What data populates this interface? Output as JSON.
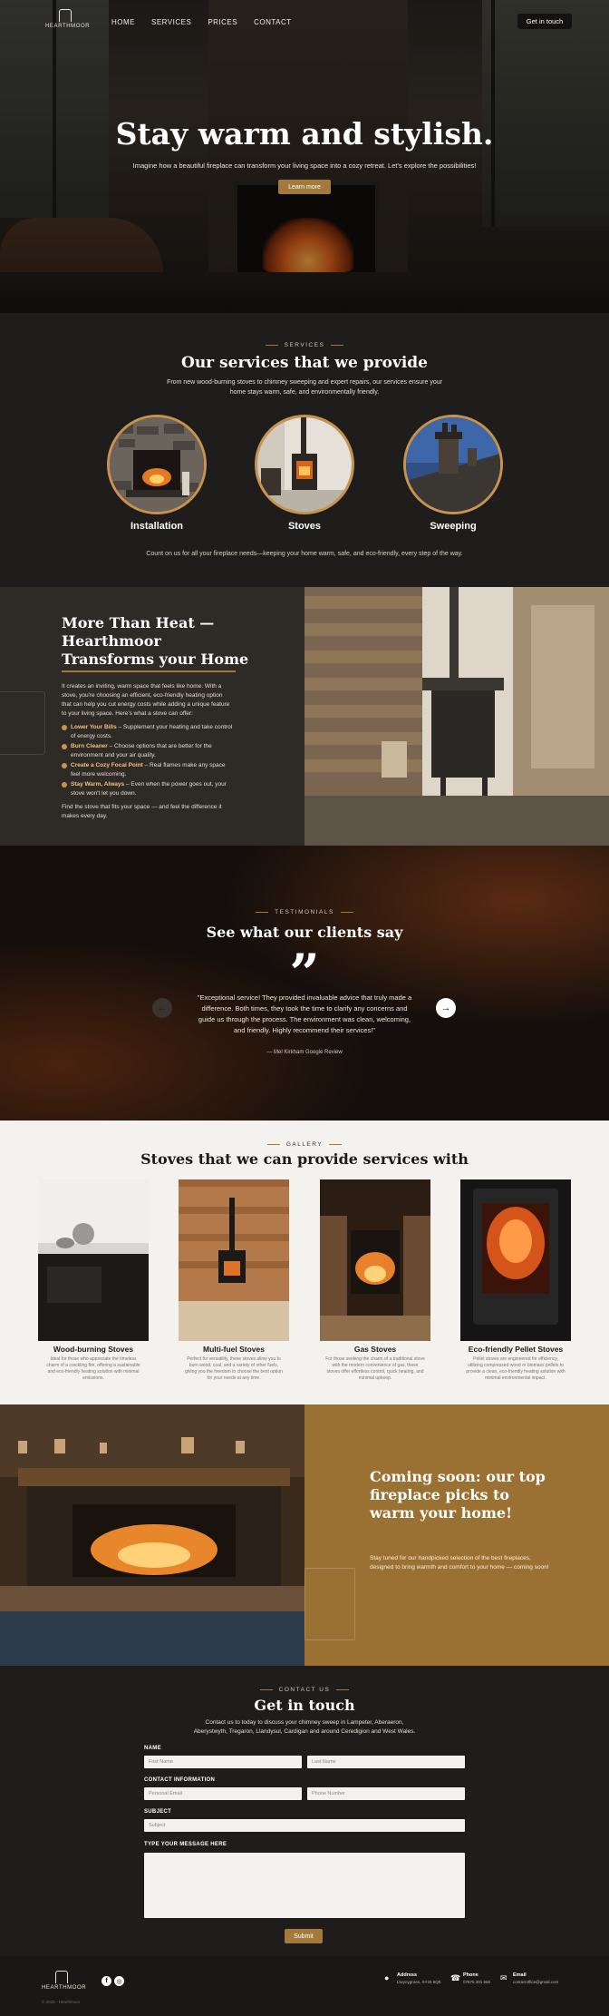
{
  "brand": {
    "name": "HEARTHMOOR"
  },
  "nav": {
    "items": [
      "HOME",
      "SERVICES",
      "PRICES",
      "CONTACT"
    ],
    "cta": "Get in touch"
  },
  "hero": {
    "title": "Stay warm and stylish.",
    "subtitle": "Imagine how a beautiful fireplace can transform your living space into a cozy retreat. Let's explore the possibilities!",
    "button": "Learn more"
  },
  "services": {
    "eyebrow": "SERVICES",
    "title": "Our services that we provide",
    "description": "From new wood-burning stoves to chimney sweeping and expert repairs, our services ensure your home stays warm, safe, and environmentally friendly.",
    "items": [
      {
        "label": "Installation"
      },
      {
        "label": "Stoves"
      },
      {
        "label": "Sweeping"
      }
    ],
    "footer": "Count on us for all your fireplace needs—keeping your home warm, safe, and eco-friendly, every step of the way."
  },
  "more": {
    "title": "More Than Heat — Hearthmoor Transforms your Home",
    "intro": "It creates an inviting, warm space that feels like home. With a stove, you're choosing an efficient, eco-friendly heating option that can help you cut energy costs while adding a unique feature to your living space. Here's what a stove can offer:",
    "benefits": [
      {
        "title": "Lower Your Bills",
        "text": " – Supplement your heating and take control of energy costs."
      },
      {
        "title": "Burn Cleaner",
        "text": " – Choose options that are better for the environment and your air quality."
      },
      {
        "title": "Create a Cozy Focal Point",
        "text": " – Real flames make any space feel more welcoming."
      },
      {
        "title": "Stay Warm, Always",
        "text": " – Even when the power goes out, your stove won't let you down."
      }
    ],
    "outro": "Find the stove that fits your space — and feel the difference it makes every day."
  },
  "testimonials": {
    "eyebrow": "TESTIMONIALS",
    "title": "See what our clients say",
    "quote_mark": "”",
    "quote": "\"Exceptional service! They provided invaluable advice that truly made a difference. Both times, they took the time to clarify any concerns and guide us through the process. The environment was clean, welcoming, and friendly. Highly recommend their services!\"",
    "author": "— Mel Kirkham Google Review",
    "prev": "←",
    "next": "→"
  },
  "gallery": {
    "eyebrow": "GALLERY",
    "title": "Stoves that we can provide services with",
    "items": [
      {
        "title": "Wood-burning Stoves",
        "text": "Ideal for those who appreciate the timeless charm of a crackling fire, offering a sustainable and eco-friendly heating solution with minimal emissions."
      },
      {
        "title": "Multi-fuel Stoves",
        "text": "Perfect for versatility, these stoves allow you to burn wood, coal, and a variety of other fuels, giving you the freedom to choose the best option for your needs at any time."
      },
      {
        "title": "Gas Stoves",
        "text": "For those seeking the charm of a traditional stove with the modern convenience of gas, these stoves offer effortless control, quick heating, and minimal upkeep."
      },
      {
        "title": "Eco-friendly Pellet Stoves",
        "text": "Pellet stoves are engineered for efficiency, utilizing compressed wood or biomass pellets to provide a clean, eco-friendly heating solution with minimal environmental impact."
      }
    ]
  },
  "soon": {
    "title": "Coming soon: our top fireplace picks to warm your home!",
    "text": "Stay tuned for our handpicked selection of the best fireplaces, designed to bring warmth and comfort to your home — coming soon!"
  },
  "contact": {
    "eyebrow": "CONTACT US",
    "title": "Get in touch",
    "description": "Contact us to today to discuss your chimney sweep in Lampeter, Aberaeron, Aberystwyth, Tregaron, Llandysul, Cardigan and around Ceredigion and West Wales.",
    "name_label": "NAME",
    "first_name": "First Name",
    "last_name": "Last Name",
    "info_label": "CONTACT INFORMATION",
    "email": "Personal Email",
    "phone": "Phone Number",
    "subject_label": "SUBJECT",
    "subject": "Subject",
    "message_label": "TYPE YOUR MESSAGE HERE",
    "submit": "Submit"
  },
  "footer": {
    "copyright": "© 2025 - Hearthmoor",
    "address_label": "Address",
    "address": "Llwynygroes, SY25 6QE",
    "phone_label": "Phone",
    "phone": "07875 301 555",
    "email_label": "Email",
    "email": "contactoffice@gmail.com",
    "social": [
      "f",
      "◎"
    ]
  },
  "colors": {
    "accent": "#a47a3c",
    "dark": "#1f1d1b",
    "panel": "#2e2a26",
    "soon_bg": "#9a7133"
  },
  "icons": [
    "logo-icon",
    "quote-icon",
    "arrow-left-icon",
    "arrow-right-icon",
    "check-icon",
    "facebook-icon",
    "instagram-icon",
    "pin-icon",
    "phone-icon",
    "mail-icon"
  ]
}
